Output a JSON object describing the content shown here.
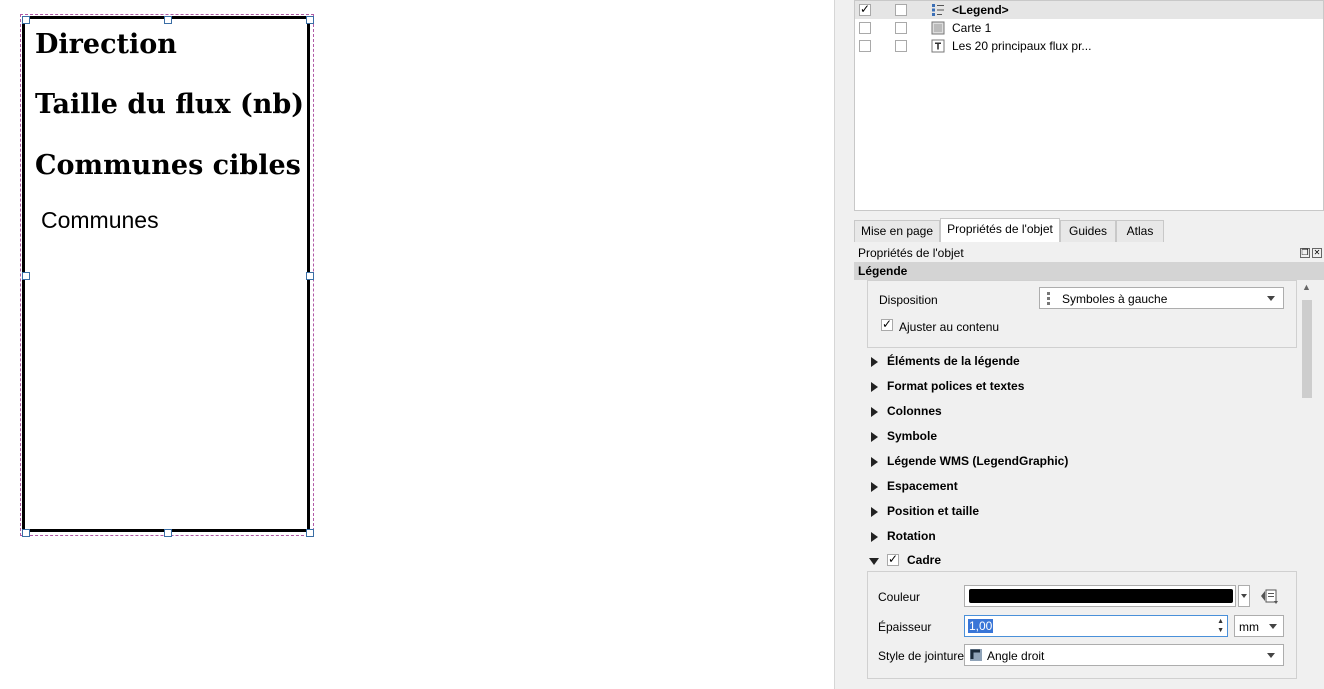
{
  "canvas": {
    "legend": {
      "titles": [
        "Direction",
        "Taille du flux (nb)",
        "Communes cibles"
      ],
      "leaf": "Communes"
    }
  },
  "items": [
    {
      "label": "<Legend>",
      "visible": true,
      "icon": "legend-icon",
      "selected": true
    },
    {
      "label": "Carte 1",
      "visible": false,
      "icon": "map-icon",
      "selected": false
    },
    {
      "label": "Les 20 principaux flux pr...",
      "visible": false,
      "icon": "text-icon",
      "selected": false
    }
  ],
  "tabs": [
    "Mise en page",
    "Propriétés de l'objet",
    "Guides",
    "Atlas"
  ],
  "active_tab": "Propriétés de l'objet",
  "panel": {
    "title": "Propriétés de l'objet",
    "section": "Légende"
  },
  "props": {
    "disposition_label": "Disposition",
    "disposition_value": "Symboles à gauche",
    "ajuster_label": "Ajuster au contenu",
    "ajuster_checked": true,
    "groups": [
      "Éléments de la légende",
      "Format polices et textes",
      "Colonnes",
      "Symbole",
      "Légende WMS (LegendGraphic)",
      "Espacement",
      "Position et taille",
      "Rotation"
    ],
    "cadre": {
      "label": "Cadre",
      "checked": true,
      "couleur_label": "Couleur",
      "couleur_value": "#000000",
      "epaisseur_label": "Épaisseur",
      "epaisseur_value": "1,00",
      "unit": "mm",
      "jointure_label": "Style de jointure",
      "jointure_value": "Angle droit"
    }
  }
}
